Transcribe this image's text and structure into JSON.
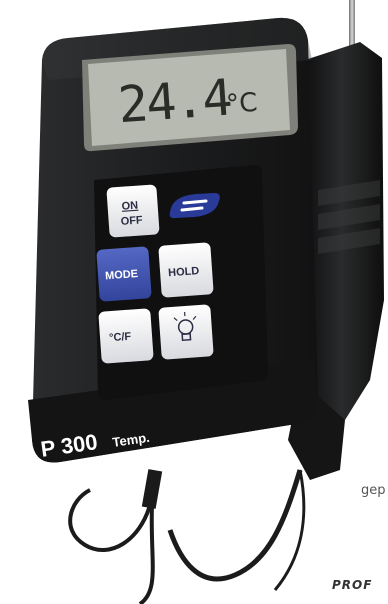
{
  "display": {
    "reading": "24.4",
    "unit": "°C"
  },
  "buttons": {
    "on_off_top": "ON",
    "on_off_bottom": "OFF",
    "mode": "MODE",
    "hold": "HOLD",
    "cf": "°C/F"
  },
  "device": {
    "model": "P 300",
    "suffix": "Temp."
  },
  "caption": {
    "partial_word": "gep",
    "footer_fragment": "PROF"
  },
  "icons": [
    "brand-logo-icon",
    "light-bulb-icon"
  ],
  "colors": {
    "body": "#1d1e1f",
    "mode_button": "#3b4fae",
    "lcd": "#b6b9b0"
  }
}
